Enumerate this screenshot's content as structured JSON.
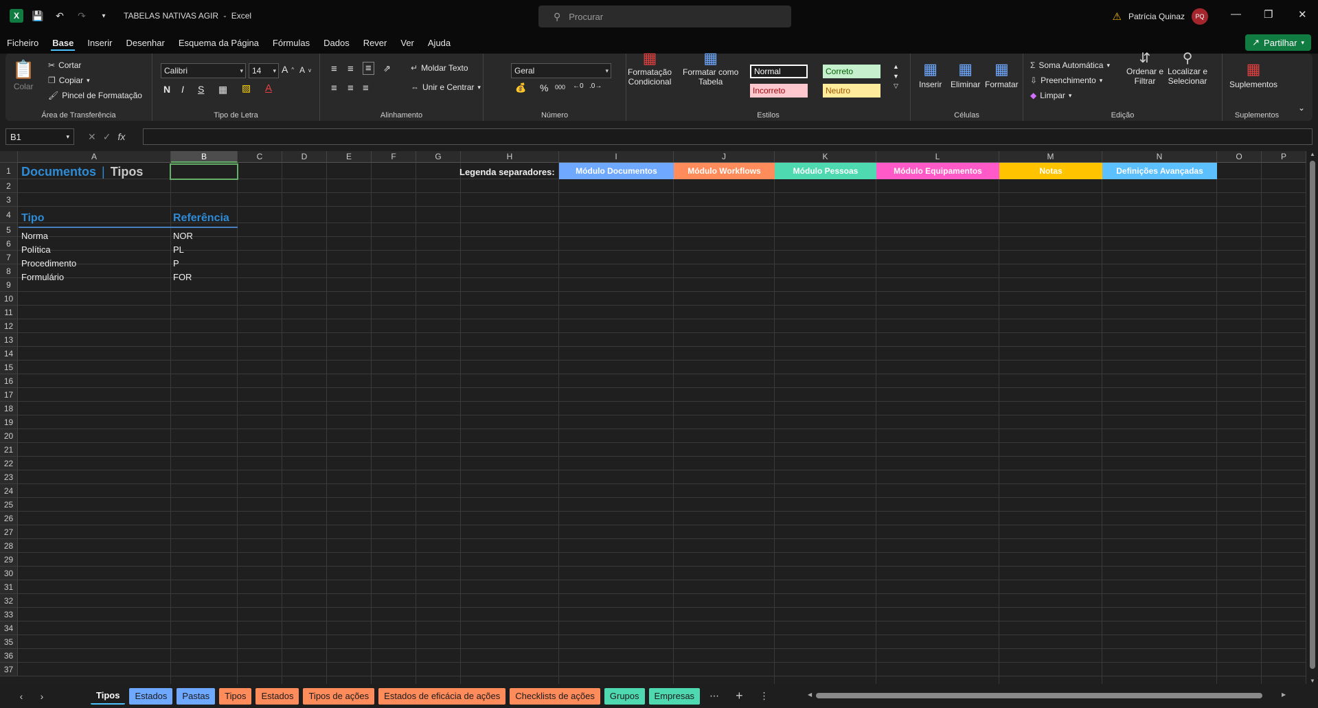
{
  "window": {
    "app_name": "Excel",
    "doc_title": "TABELAS NATIVAS AGIR",
    "title_sep": "-",
    "search_placeholder": "Procurar",
    "user_name": "Patrícia Quinaz",
    "user_initials": "PQ"
  },
  "menu": [
    "Ficheiro",
    "Base",
    "Inserir",
    "Desenhar",
    "Esquema da Página",
    "Fórmulas",
    "Dados",
    "Rever",
    "Ver",
    "Ajuda"
  ],
  "share_label": "Partilhar",
  "ribbon": {
    "clipboard": {
      "paste": "Colar",
      "cut": "Cortar",
      "copy": "Copiar",
      "format_painter": "Pincel de Formatação",
      "label": "Área de Transferência"
    },
    "font": {
      "name": "Calibri",
      "size": "14",
      "bold": "N",
      "italic": "I",
      "underline": "S",
      "label": "Tipo de Letra"
    },
    "alignment": {
      "wrap": "Moldar Texto",
      "merge": "Unir e Centrar",
      "label": "Alinhamento"
    },
    "number": {
      "format": "Geral",
      "label": "Número"
    },
    "styles": {
      "cond_line1": "Formatação",
      "cond_line2": "Condicional",
      "table_line1": "Formatar como",
      "table_line2": "Tabela",
      "normal": "Normal",
      "correct": "Correto",
      "incorrect": "Incorreto",
      "neutral": "Neutro",
      "label": "Estilos"
    },
    "cells": {
      "insert": "Inserir",
      "delete": "Eliminar",
      "format": "Formatar",
      "label": "Células"
    },
    "editing": {
      "autosum": "Soma Automática",
      "fill": "Preenchimento",
      "clear": "Limpar",
      "sort_line1": "Ordenar e",
      "sort_line2": "Filtrar",
      "find_line1": "Localizar e",
      "find_line2": "Selecionar",
      "label": "Edição"
    },
    "addins": {
      "button": "Suplementos",
      "label": "Suplementos"
    }
  },
  "formula_bar": {
    "cell_ref": "B1",
    "fx": "fx",
    "value": ""
  },
  "columns": [
    "A",
    "B",
    "C",
    "D",
    "E",
    "F",
    "G",
    "H",
    "I",
    "J",
    "K",
    "L",
    "M",
    "N",
    "O",
    "P"
  ],
  "rows": [
    "1",
    "2",
    "3",
    "4",
    "5",
    "6",
    "7",
    "8",
    "9",
    "10",
    "11",
    "12",
    "13",
    "14",
    "15",
    "16",
    "17",
    "18",
    "19",
    "20",
    "21",
    "22",
    "23",
    "24",
    "25",
    "26",
    "27",
    "28",
    "29",
    "30",
    "31",
    "32",
    "33",
    "34",
    "35",
    "36",
    "37"
  ],
  "sheet": {
    "title_part1": "Documentos",
    "title_sep": "|",
    "title_part2": "Tipos",
    "header_tipo": "Tipo",
    "header_ref": "Referência",
    "data_rows": [
      {
        "tipo": "Norma",
        "ref": "NOR"
      },
      {
        "tipo": "Política",
        "ref": "PL"
      },
      {
        "tipo": "Procedimento",
        "ref": "P"
      },
      {
        "tipo": "Formulário",
        "ref": "FOR"
      }
    ],
    "legend_label": "Legenda separadores:",
    "legend": [
      {
        "label": "Módulo Documentos",
        "color": "#6fa8ff"
      },
      {
        "label": "Módulo Workflows",
        "color": "#ff8c5a"
      },
      {
        "label": "Módulo Pessoas",
        "color": "#4fd9b0"
      },
      {
        "label": "Módulo Equipamentos",
        "color": "#ff5ac8"
      },
      {
        "label": "Notas",
        "color": "#ffc300"
      },
      {
        "label": "Definições Avançadas",
        "color": "#5cc0ff"
      }
    ]
  },
  "tabs": [
    {
      "label": "Tipos",
      "color": "#1e1e1e",
      "active": true
    },
    {
      "label": "Estados",
      "color": "#6fa8ff"
    },
    {
      "label": "Pastas",
      "color": "#6fa8ff"
    },
    {
      "label": "Tipos",
      "color": "#ff8c5a"
    },
    {
      "label": "Estados",
      "color": "#ff8c5a"
    },
    {
      "label": "Tipos de ações",
      "color": "#ff8c5a"
    },
    {
      "label": "Estados de eficácia de ações",
      "color": "#ff8c5a"
    },
    {
      "label": "Checklists de ações",
      "color": "#ff8c5a"
    },
    {
      "label": "Grupos",
      "color": "#4fd9b0"
    },
    {
      "label": "Empresas",
      "color": "#4fd9b0"
    }
  ],
  "colors": {
    "accent_blue": "#2e8bd6",
    "excel_green": "#107c41",
    "selection_green": "#66b06a"
  }
}
